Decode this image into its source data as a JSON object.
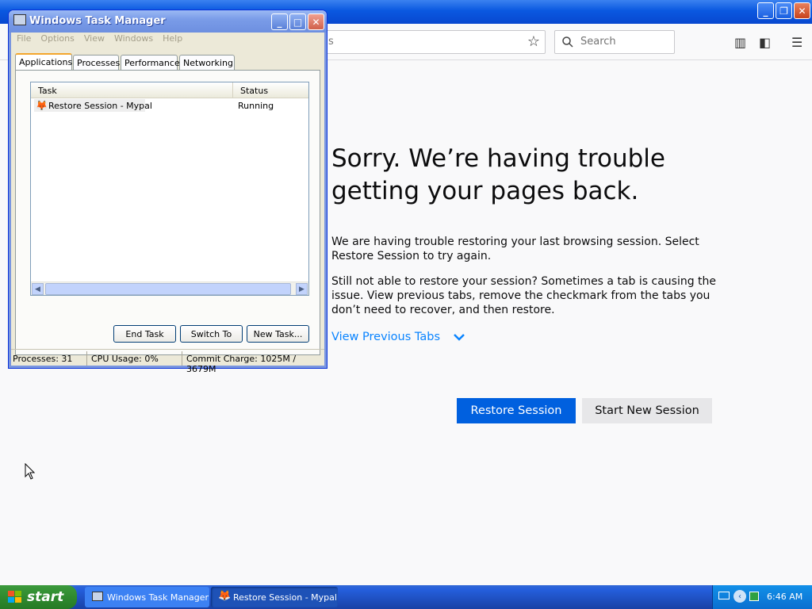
{
  "browser": {
    "window_controls": {
      "minimize": "_",
      "restore": "❐",
      "close": "✕"
    },
    "search_placeholder": "Search",
    "url_fragment": "s",
    "error": {
      "heading_line1": "Sorry. We’re having trouble",
      "heading_line2": "getting your pages back.",
      "para1": "We are having trouble restoring your last browsing session. Select Restore Session to try again.",
      "para2": "Still not able to restore your session? Sometimes a tab is causing the issue. View previous tabs, remove the checkmark from the tabs you don’t need to recover, and then restore.",
      "view_previous_tabs": "View Previous Tabs",
      "restore_button": "Restore Session",
      "new_session_button": "Start New Session"
    }
  },
  "task_manager": {
    "title": "Windows Task Manager",
    "menu": [
      "File",
      "Options",
      "View",
      "Windows",
      "Help"
    ],
    "tabs": [
      "Applications",
      "Processes",
      "Performance",
      "Networking"
    ],
    "active_tab": "Applications",
    "columns": {
      "task": "Task",
      "status": "Status"
    },
    "rows": [
      {
        "task": "Restore Session - Mypal",
        "status": "Running"
      }
    ],
    "buttons": {
      "end_task": "End Task",
      "switch_to": "Switch To",
      "new_task": "New Task..."
    },
    "statusbar": {
      "processes": "Processes: 31",
      "cpu": "CPU Usage: 0%",
      "commit": "Commit Charge: 1025M / 3679M"
    }
  },
  "taskbar": {
    "start_label": "start",
    "items": [
      "Windows Task Manager",
      "Restore Session - Mypal"
    ],
    "clock": "6:46 AM"
  },
  "colors": {
    "accent": "#0060df",
    "link": "#0a84ff",
    "xp_blue": "#245edb",
    "start_green": "#2f8a2f"
  }
}
